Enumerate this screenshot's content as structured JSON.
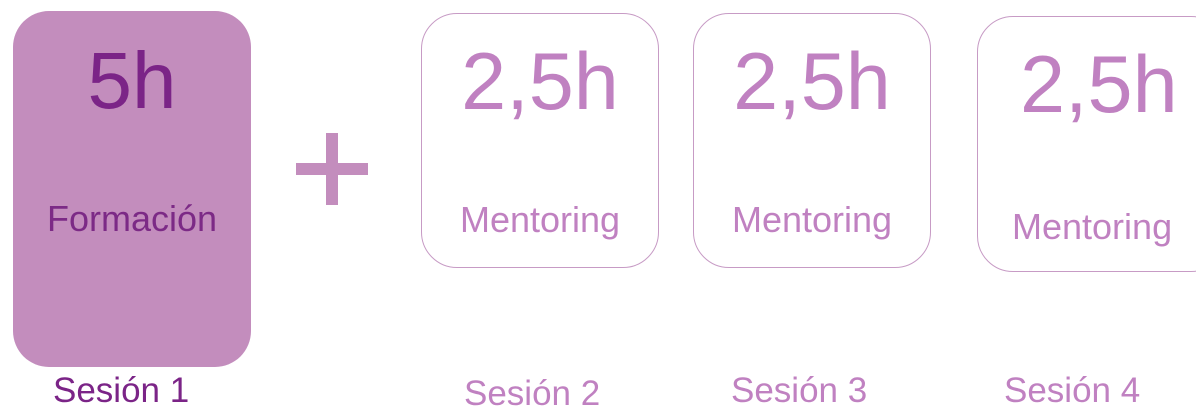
{
  "colors": {
    "accent_fill": "#c38dbd",
    "accent_text_dark": "#7b2487",
    "accent_text_light": "#c081c1",
    "outline": "#c79bc5",
    "background": "#ffffff"
  },
  "icons": {
    "plus": "plus-icon"
  },
  "sessions": [
    {
      "hours": "5h",
      "label": "Formación",
      "session_label": "Sesión 1"
    },
    {
      "hours": "2,5h",
      "label": "Mentoring",
      "session_label": "Sesión 2"
    },
    {
      "hours": "2,5h",
      "label": "Mentoring",
      "session_label": "Sesión 3"
    },
    {
      "hours": "2,5h",
      "label": "Mentoring",
      "session_label": "Sesión 4"
    }
  ]
}
